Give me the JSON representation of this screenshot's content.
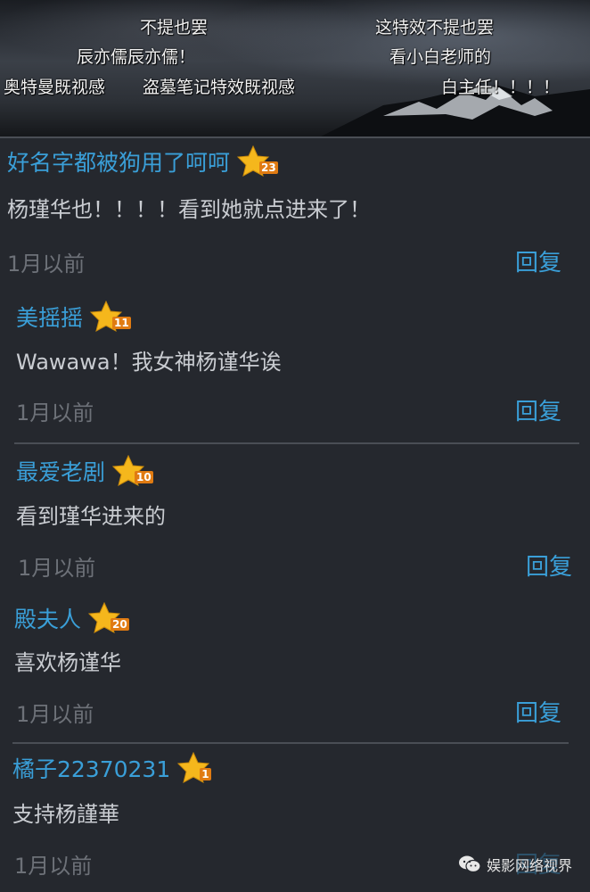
{
  "danmaku": [
    "不提也罢",
    "这特效不提也罢",
    "辰亦儒辰亦儒！",
    "看小白老师的",
    "奥特曼既视感",
    "盗墓笔记特效既视感",
    "白主任！！！！"
  ],
  "comments": [
    {
      "username": "好名字都被狗用了呵呵",
      "level": "23",
      "text": "杨瑾华也！！！！看到她就点进来了！",
      "time": "1月以前",
      "reply": "回复"
    },
    {
      "username": "美摇摇",
      "level": "11",
      "text": "Wawawa！我女神杨谨华诶",
      "time": "1月以前",
      "reply": "回复"
    },
    {
      "username": "最爱老剧",
      "level": "10",
      "text": "看到瑾华进来的",
      "time": "1月以前",
      "reply": "回复"
    },
    {
      "username": "殿夫人",
      "level": "20",
      "text": "喜欢杨谨华",
      "time": "1月以前",
      "reply": "回复"
    },
    {
      "username": "橘子22370231",
      "level": "1",
      "text": "支持杨謹華",
      "time": "1月以前",
      "reply": "回复"
    }
  ],
  "watermark": {
    "icon": "wechat-icon",
    "text": "娱影网络视界"
  },
  "colors": {
    "background": "#25282e",
    "username": "#3a9fd8",
    "reply": "#3a9fd8",
    "level_badge": "#e07b12",
    "star": "#f5b71c"
  }
}
